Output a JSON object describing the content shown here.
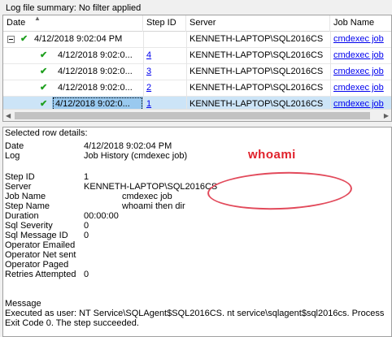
{
  "summary": "Log file summary: No filter applied",
  "grid": {
    "columns": [
      "Date",
      "Step ID",
      "Server",
      "Job Name"
    ],
    "rows": [
      {
        "date": "4/12/2018 9:02:04 PM",
        "step_id": "",
        "server": "KENNETH-LAPTOP\\SQL2016CS",
        "job": "cmdexec job"
      },
      {
        "date": "4/12/2018 9:02:0...",
        "step_id": "4",
        "server": "KENNETH-LAPTOP\\SQL2016CS",
        "job": "cmdexec job"
      },
      {
        "date": "4/12/2018 9:02:0...",
        "step_id": "3",
        "server": "KENNETH-LAPTOP\\SQL2016CS",
        "job": "cmdexec job"
      },
      {
        "date": "4/12/2018 9:02:0...",
        "step_id": "2",
        "server": "KENNETH-LAPTOP\\SQL2016CS",
        "job": "cmdexec job"
      },
      {
        "date": "4/12/2018 9:02:0...",
        "step_id": "1",
        "server": "KENNETH-LAPTOP\\SQL2016CS",
        "job": "cmdexec job"
      }
    ]
  },
  "details": {
    "header": "Selected row details:",
    "date_label": "Date",
    "date_value": "4/12/2018 9:02:04 PM",
    "log_label": "Log",
    "log_value": "Job History (cmdexec job)",
    "step_id_label": "Step ID",
    "step_id_value": "1",
    "server_label": "Server",
    "server_value": "KENNETH-LAPTOP\\SQL2016CS",
    "job_name_label": "Job Name",
    "job_name_value": "cmdexec job",
    "step_name_label": "Step Name",
    "step_name_value": "whoami then dir",
    "duration_label": "Duration",
    "duration_value": "00:00:00",
    "sql_severity_label": "Sql Severity",
    "sql_severity_value": "0",
    "sql_msg_id_label": "Sql Message ID",
    "sql_msg_id_value": "0",
    "op_emailed_label": "Operator Emailed",
    "op_net_sent_label": "Operator Net sent",
    "op_paged_label": "Operator Paged",
    "retries_label": "Retries Attempted",
    "retries_value": "0",
    "message_label": "Message",
    "message_line1": "Executed as user: NT Service\\SQLAgent$SQL2016CS. nt service\\sqlagent$sql2016cs. Process",
    "message_line2": "Exit Code 0.  The step succeeded."
  },
  "annotation": {
    "text": "whoami",
    "color": "#e0202a"
  }
}
